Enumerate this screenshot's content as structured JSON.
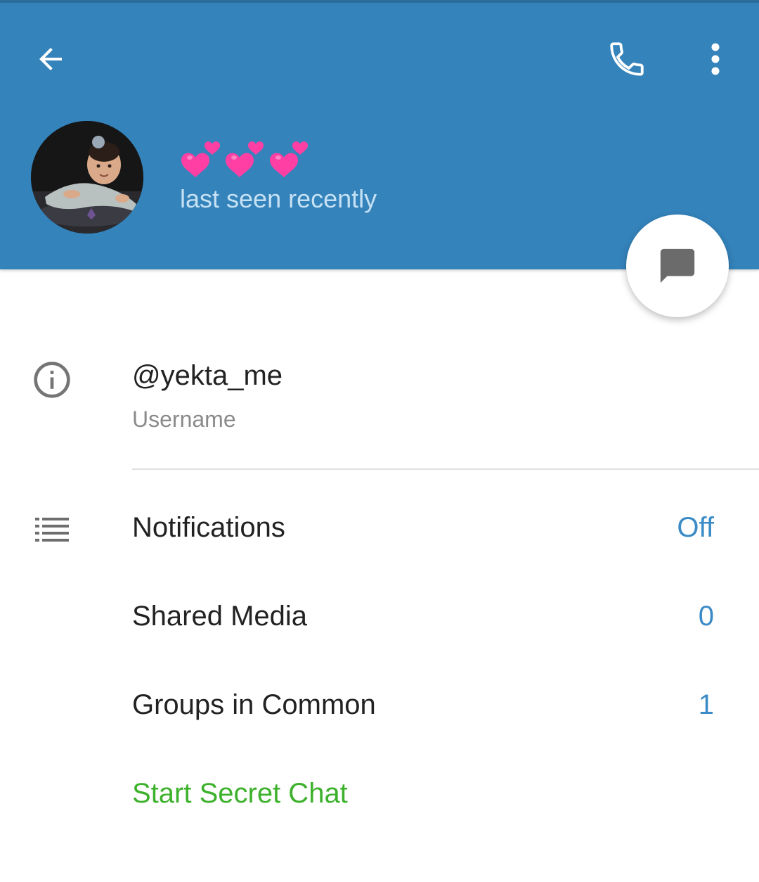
{
  "profile": {
    "name": "💕💕💕",
    "status": "last seen recently",
    "avatar_alt": "avatar"
  },
  "username": {
    "value": "@yekta_me",
    "label": "Username"
  },
  "rows": {
    "notifications": {
      "label": "Notifications",
      "value": "Off"
    },
    "shared_media": {
      "label": "Shared Media",
      "value": "0"
    },
    "groups_in_common": {
      "label": "Groups in Common",
      "value": "1"
    },
    "secret_chat": {
      "label": "Start Secret Chat"
    }
  },
  "icons": {
    "back": "arrow-left-icon",
    "call": "phone-icon",
    "more": "more-vertical-icon",
    "message": "chat-bubble-icon",
    "info": "info-icon",
    "notifications": "list-icon"
  },
  "colors": {
    "header": "#3483bb",
    "status_text": "#c6e1f3",
    "value_blue": "#3a8bc6",
    "secret_green": "#3db12c",
    "heart_pink": "#ff3fa4"
  }
}
